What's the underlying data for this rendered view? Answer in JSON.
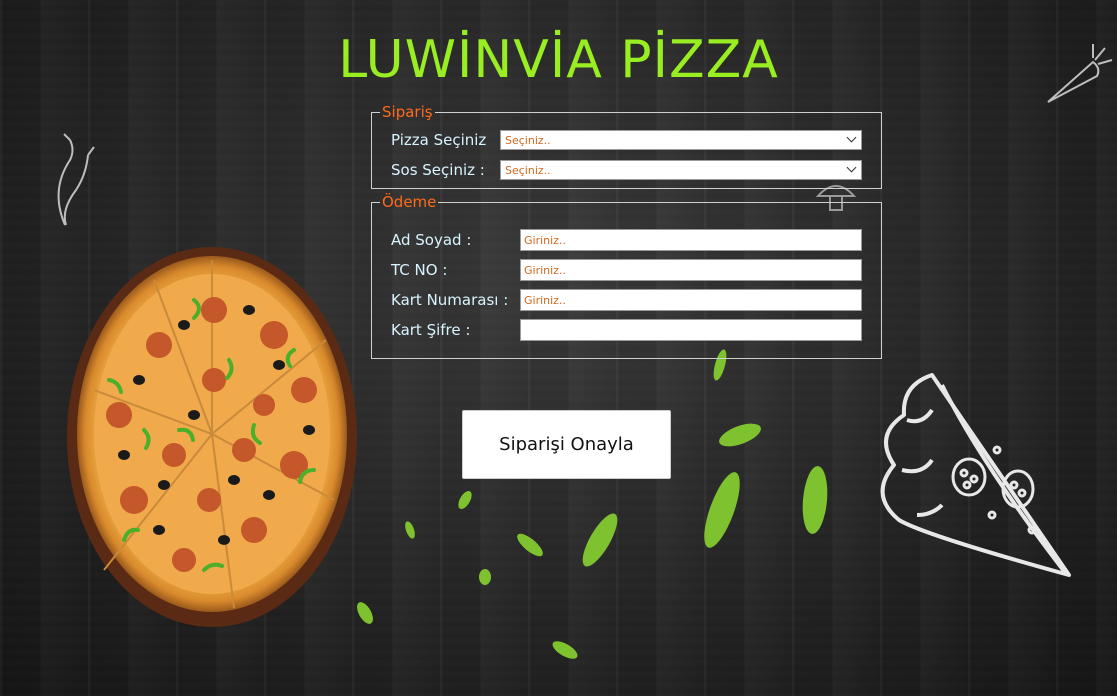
{
  "app": {
    "title": "LUWİNVİA PİZZA"
  },
  "order_section": {
    "legend": "Sipariş",
    "pizza_label": "Pizza Seçiniz",
    "pizza_value": "Seçiniz..",
    "sauce_label": "Sos Seçiniz :",
    "sauce_value": "Seçiniz.."
  },
  "payment_section": {
    "legend": "Ödeme",
    "name_label": "Ad Soyad :",
    "name_value": "Giriniz..",
    "tc_label": "TC NO :",
    "tc_value": "Giriniz..",
    "card_label": "Kart Numarası :",
    "card_value": "Giriniz..",
    "pin_label": "Kart Şifre :",
    "pin_value": ""
  },
  "confirm_button": {
    "label": "Siparişi Onayla"
  },
  "colors": {
    "title": "#99ee22",
    "legend": "#ff6a1a",
    "label": "#d8f4ff",
    "placeholder": "#d2691e"
  },
  "icons": [
    "pizza-image",
    "pizza-slice-sketch",
    "chili-sketch",
    "carrot-sketch",
    "mushroom-sketch",
    "leaf-decoration",
    "chevron-down-icon"
  ]
}
